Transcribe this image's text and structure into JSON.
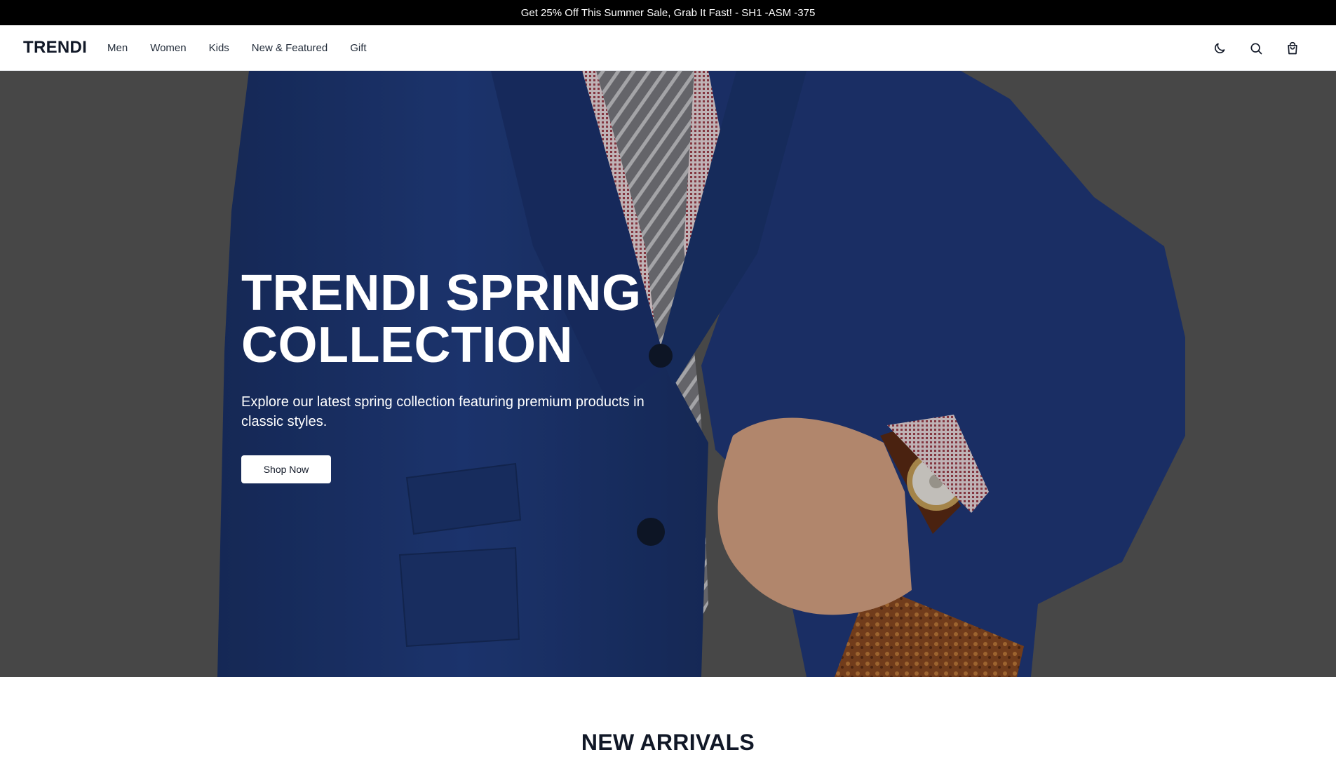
{
  "announcement": {
    "text": "Get 25% Off This Summer Sale, Grab It Fast! - SH1 -ASM -375"
  },
  "header": {
    "logo": "TRENDI",
    "nav": [
      "Men",
      "Women",
      "Kids",
      "New & Featured",
      "Gift"
    ],
    "icons": [
      "moon-icon",
      "search-icon",
      "shopping-bag-icon"
    ]
  },
  "hero": {
    "title_line1": "TRENDI SPRING",
    "title_line2": "COLLECTION",
    "subtitle": "Explore our latest spring collection featuring premium products in classic styles.",
    "button_label": "Shop Now"
  },
  "new_arrivals": {
    "title": "NEW ARRIVALS"
  },
  "colors": {
    "announcement_bg": "#000000",
    "hero_bg": "#575757",
    "suit": "#1f3a78",
    "text_dark": "#111827"
  }
}
